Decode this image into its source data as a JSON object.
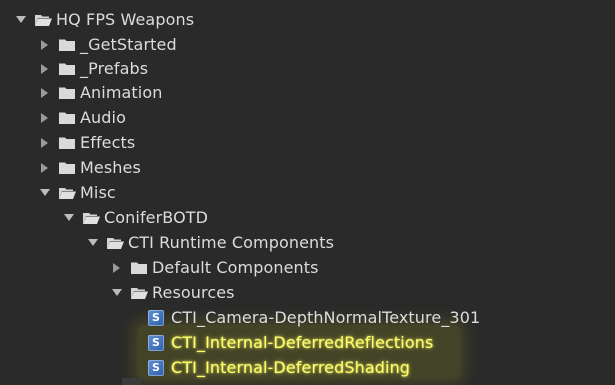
{
  "project": {
    "root": {
      "label": "HQ FPS Weapons",
      "expanded": true
    },
    "items": [
      {
        "label": "_GetStarted",
        "type": "folder",
        "expanded": false
      },
      {
        "label": "_Prefabs",
        "type": "folder",
        "expanded": false
      },
      {
        "label": "Animation",
        "type": "folder",
        "expanded": false
      },
      {
        "label": "Audio",
        "type": "folder",
        "expanded": false
      },
      {
        "label": "Effects",
        "type": "folder",
        "expanded": false
      },
      {
        "label": "Meshes",
        "type": "folder",
        "expanded": false
      },
      {
        "label": "Misc",
        "type": "folder",
        "expanded": true
      },
      {
        "label": "ConiferBOTD",
        "type": "folder",
        "expanded": true
      },
      {
        "label": "CTI Runtime Components",
        "type": "folder",
        "expanded": true
      },
      {
        "label": "Default Components",
        "type": "folder",
        "expanded": false
      },
      {
        "label": "Resources",
        "type": "folder",
        "expanded": true
      },
      {
        "label": "CTI_Camera-DepthNormalTexture_301",
        "type": "shader"
      },
      {
        "label": "CTI_Internal-DeferredReflections",
        "type": "shader",
        "highlighted": true
      },
      {
        "label": "CTI_Internal-DeferredShading",
        "type": "shader",
        "highlighted": true
      }
    ]
  },
  "icons": {
    "folder_closed": "folder-icon",
    "folder_open": "folder-open-icon",
    "shader": "shader-icon",
    "expand": "chevron-right-icon",
    "collapse": "chevron-down-icon"
  },
  "colors": {
    "background": "#2a2a2a",
    "text": "#dcdcdc",
    "highlight_text": "#ffff6c",
    "shader_icon": "#3e6fbf"
  }
}
